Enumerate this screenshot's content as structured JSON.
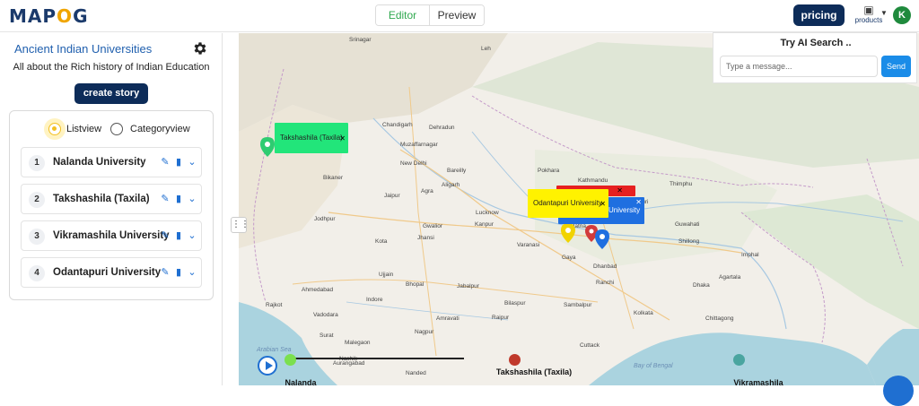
{
  "header": {
    "logo": "MAPOG",
    "tabs": [
      {
        "label": "Editor",
        "active": true
      },
      {
        "label": "Preview",
        "active": false
      }
    ],
    "pricing_label": "pricing",
    "products_label": "products",
    "avatar_initial": "K"
  },
  "sidebar": {
    "title": "Ancient Indian Universities",
    "subtitle": "All about the Rich history of Indian Education",
    "create_story_label": "create story",
    "views": [
      {
        "label": "Listview",
        "selected": true
      },
      {
        "label": "Categoryview",
        "selected": false
      }
    ],
    "items": [
      {
        "number": "1",
        "name": "Nalanda University"
      },
      {
        "number": "2",
        "name": "Takshashila (Taxila)"
      },
      {
        "number": "3",
        "name": "Vikramashila University"
      },
      {
        "number": "4",
        "name": "Odantapuri University"
      }
    ]
  },
  "ai_search": {
    "title": "Try AI Search ..",
    "placeholder": "Type a message...",
    "send_label": "Send"
  },
  "map": {
    "popups": [
      {
        "label": "Takshashila (Taxila)",
        "color": "#22e57a"
      },
      {
        "label": "Odantapuri University",
        "color": "#fff200"
      },
      {
        "label": "University",
        "color": "#1f6fe0"
      }
    ],
    "place_labels": [
      "Srinagar",
      "Leh",
      "Chandigarh",
      "Dehradun",
      "Muzaffarnagar",
      "New Delhi",
      "Jaipur",
      "Bikaner",
      "Jodhpur",
      "Lucknow",
      "Kanpur",
      "Agra",
      "Gwalior",
      "Varanasi",
      "Patna",
      "Gaya",
      "Jhansi",
      "Bhopal",
      "Jabalpur",
      "Indore",
      "Ujjain",
      "Ahmedabad",
      "Vadodara",
      "Surat",
      "Nashik",
      "Malegaon",
      "Nagpur",
      "Raipur",
      "Bilaspur",
      "Ranchi",
      "Dhanbad",
      "Kolkata",
      "Siliguri",
      "Guwahati",
      "Shillong",
      "Dhaka",
      "Cuttack",
      "Nanded",
      "Aurangabad",
      "Kathmandu",
      "Pokhara",
      "Thimphu",
      "Imphal",
      "Agartala",
      "Bareilly",
      "Aligarh",
      "Kota",
      "Rajkot",
      "Amravati",
      "Sambalpur",
      "Chittagong",
      "Bay of Bengal",
      "Arabian Sea"
    ]
  },
  "timeline": {
    "points": [
      {
        "label": "Nalanda",
        "color": "#7be04f"
      },
      {
        "label": "Takshashila (Taxila)",
        "color": "#c0392b"
      },
      {
        "label": "Vikramashila",
        "color": "#4aa5a0"
      }
    ]
  }
}
